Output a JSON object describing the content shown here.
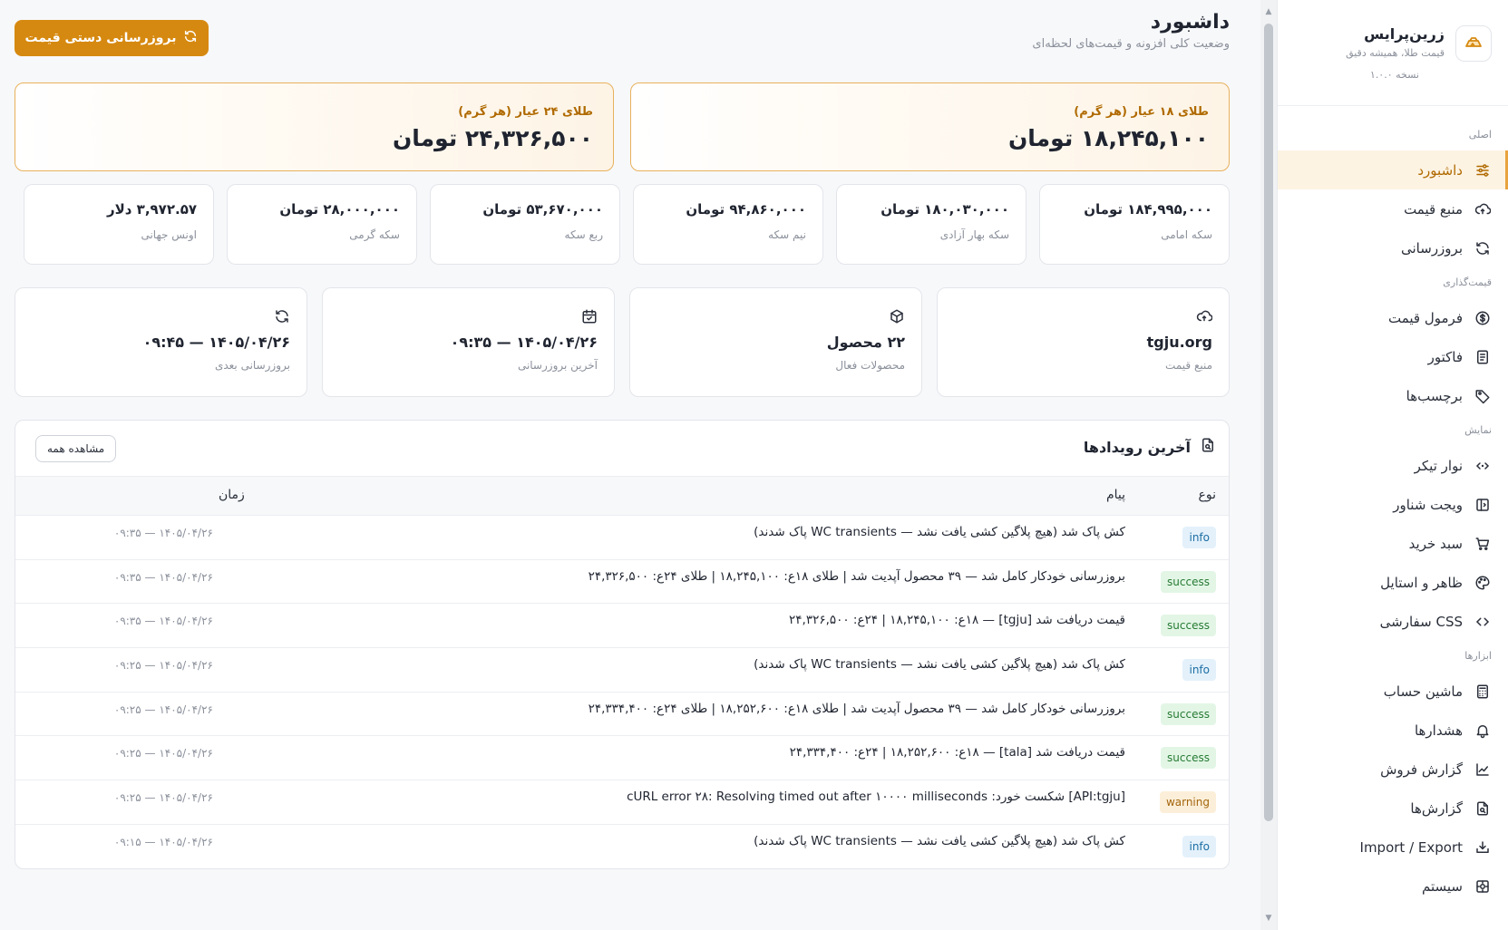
{
  "brand": {
    "name": "زرین‌پرایس",
    "tagline": "قیمت طلا، همیشه دقیق",
    "version": "نسخه ۱.۰.۰"
  },
  "sidebar": {
    "sections": [
      {
        "title": "اصلی",
        "items": [
          {
            "label": "داشبورد",
            "icon": "sliders-icon",
            "active": true
          },
          {
            "label": "منبع قیمت",
            "icon": "cloud-sync-icon"
          },
          {
            "label": "بروزرسانی",
            "icon": "refresh-icon"
          }
        ]
      },
      {
        "title": "قیمت‌گذاری",
        "items": [
          {
            "label": "فرمول قیمت",
            "icon": "dollar-circle-icon"
          },
          {
            "label": "فاکتور",
            "icon": "document-icon"
          },
          {
            "label": "برچسب‌ها",
            "icon": "tag-icon"
          }
        ]
      },
      {
        "title": "نمایش",
        "items": [
          {
            "label": "نوار تیکر",
            "icon": "code-arrows-icon"
          },
          {
            "label": "ویجت شناور",
            "icon": "sidebar-panel-icon"
          },
          {
            "label": "سبد خرید",
            "icon": "cart-icon"
          },
          {
            "label": "ظاهر و استایل",
            "icon": "palette-icon"
          },
          {
            "label": "CSS سفارشی",
            "icon": "code-icon"
          }
        ]
      },
      {
        "title": "ابزارها",
        "items": [
          {
            "label": "ماشین حساب",
            "icon": "calculator-icon"
          },
          {
            "label": "هشدارها",
            "icon": "bell-icon"
          },
          {
            "label": "گزارش فروش",
            "icon": "trend-chart-icon"
          },
          {
            "label": "گزارش‌ها",
            "icon": "file-search-icon"
          },
          {
            "label": "Import / Export",
            "icon": "download-tray-icon"
          },
          {
            "label": "سیستم",
            "icon": "system-icon"
          }
        ]
      }
    ]
  },
  "header": {
    "title": "داشبورد",
    "subtitle": "وضعیت کلی افزونه و قیمت‌های لحظه‌ای",
    "refresh_button": "بروزرسانی دستی قیمت"
  },
  "gold": [
    {
      "label": "طلای ۱۸ عیار (هر گرم)",
      "value": "۱۸,۲۴۵,۱۰۰ تومان"
    },
    {
      "label": "طلای ۲۴ عیار (هر گرم)",
      "value": "۲۴,۳۲۶,۵۰۰ تومان"
    }
  ],
  "coins": [
    {
      "label": "سکه امامی",
      "value": "۱۸۴,۹۹۵,۰۰۰ تومان"
    },
    {
      "label": "سکه بهار آزادی",
      "value": "۱۸۰,۰۳۰,۰۰۰ تومان"
    },
    {
      "label": "نیم سکه",
      "value": "۹۴,۸۶۰,۰۰۰ تومان"
    },
    {
      "label": "ربع سکه",
      "value": "۵۳,۶۷۰,۰۰۰ تومان"
    },
    {
      "label": "سکه گرمی",
      "value": "۲۸,۰۰۰,۰۰۰ تومان"
    },
    {
      "label": "اونس جهانی",
      "value": "۳,۹۷۲.۵۷ دلار"
    }
  ],
  "stats": [
    {
      "label": "منبع قیمت",
      "value": "tgju.org",
      "icon": "cloud-sync-icon"
    },
    {
      "label": "محصولات فعال",
      "value": "۲۲ محصول",
      "icon": "box-icon"
    },
    {
      "label": "آخرین بروزرسانی",
      "value": "۱۴۰۵/۰۴/۲۶ — ۰۹:۳۵",
      "icon": "calendar-sync-icon"
    },
    {
      "label": "بروزرسانی بعدی",
      "value": "۱۴۰۵/۰۴/۲۶ — ۰۹:۴۵",
      "icon": "refresh-icon"
    }
  ],
  "events": {
    "title": "آخرین رویدادها",
    "view_all": "مشاهده همه",
    "columns": {
      "type": "نوع",
      "message": "پیام",
      "time": "زمان"
    },
    "rows": [
      {
        "type": "info",
        "message": "کش پاک شد (هیچ پلاگین کشی یافت نشد — WC transients پاک شدند)",
        "time": "۱۴۰۵/۰۴/۲۶ — ۰۹:۳۵"
      },
      {
        "type": "success",
        "message": "بروزرسانی خودکار کامل شد — ۳۹ محصول آپدیت شد | طلای ۱۸ع: ۱۸,۲۴۵,۱۰۰ | طلای ۲۴ع: ۲۴,۳۲۶,۵۰۰",
        "time": "۱۴۰۵/۰۴/۲۶ — ۰۹:۳۵"
      },
      {
        "type": "success",
        "message": "قیمت دریافت شد [tgju] — ۱۸ع: ۱۸,۲۴۵,۱۰۰ | ۲۴ع: ۲۴,۳۲۶,۵۰۰",
        "time": "۱۴۰۵/۰۴/۲۶ — ۰۹:۳۵"
      },
      {
        "type": "info",
        "message": "کش پاک شد (هیچ پلاگین کشی یافت نشد — WC transients پاک شدند)",
        "time": "۱۴۰۵/۰۴/۲۶ — ۰۹:۲۵"
      },
      {
        "type": "success",
        "message": "بروزرسانی خودکار کامل شد — ۳۹ محصول آپدیت شد | طلای ۱۸ع: ۱۸,۲۵۲,۶۰۰ | طلای ۲۴ع: ۲۴,۳۳۴,۴۰۰",
        "time": "۱۴۰۵/۰۴/۲۶ — ۰۹:۲۵"
      },
      {
        "type": "success",
        "message": "قیمت دریافت شد [tala] — ۱۸ع: ۱۸,۲۵۲,۶۰۰ | ۲۴ع: ۲۴,۳۳۴,۴۰۰",
        "time": "۱۴۰۵/۰۴/۲۶ — ۰۹:۲۵"
      },
      {
        "type": "warning",
        "message": "[API:tgju] شکست خورد: cURL error ۲۸: Resolving timed out after ۱۰۰۰۰ milliseconds",
        "time": "۱۴۰۵/۰۴/۲۶ — ۰۹:۲۵"
      },
      {
        "type": "info",
        "message": "کش پاک شد (هیچ پلاگین کشی یافت نشد — WC transients پاک شدند)",
        "time": "۱۴۰۵/۰۴/۲۶ — ۰۹:۱۵"
      }
    ]
  },
  "colors": {
    "accent": "#d68910",
    "accent_light": "#fdf3e3"
  }
}
